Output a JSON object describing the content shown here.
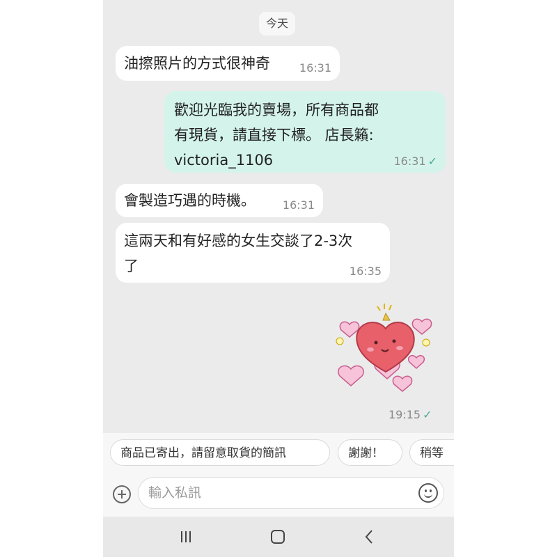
{
  "chat": {
    "date_label": "今天",
    "messages": [
      {
        "direction": "incoming",
        "lines": [
          "油擦照片的方式很神奇"
        ],
        "time": "16:31"
      },
      {
        "direction": "outgoing",
        "lines": [
          "歡迎光臨我的賣場，所有商品都",
          "有現貨，請直接下標。 店長籟:",
          "victoria_1106"
        ],
        "time": "16:31",
        "read": true
      },
      {
        "direction": "incoming",
        "lines": [
          "會製造巧遇的時機。"
        ],
        "time": "16:31"
      },
      {
        "direction": "incoming",
        "lines": [
          "這兩天和有好感的女生交談了2-3次",
          "了"
        ],
        "time": "16:35"
      },
      {
        "direction": "outgoing",
        "type": "sticker",
        "sticker_icon": "heart-character-sticker",
        "time": "19:15",
        "read": true
      }
    ],
    "read_tick": "✓"
  },
  "quick_replies": [
    "商品已寄出，請留意取貨的簡訊",
    "謝謝！",
    "稍等"
  ],
  "composer": {
    "placeholder": "輸入私訊",
    "attach_icon": "plus-icon",
    "emoji_icon": "emoji-icon"
  },
  "system_nav": {
    "icons": [
      "recent-apps-icon",
      "home-icon",
      "back-icon"
    ]
  },
  "colors": {
    "background": "#ebebeb",
    "incoming_bubble": "#ffffff",
    "outgoing_bubble": "#d4f4eb",
    "read_tick": "#4aa896"
  }
}
